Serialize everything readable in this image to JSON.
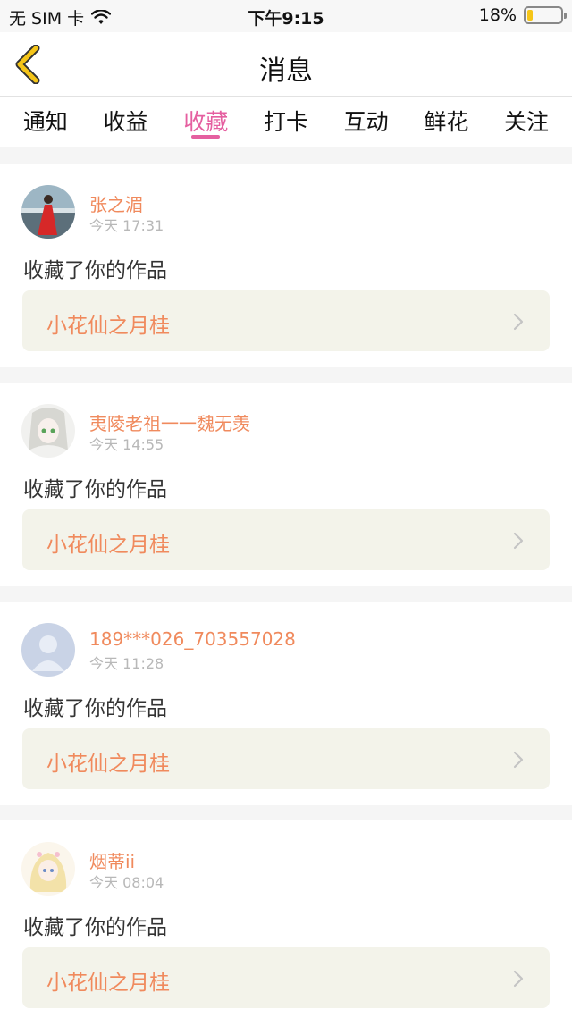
{
  "status_bar": {
    "carrier": "无 SIM 卡",
    "time": "下午9:15",
    "battery": "18%",
    "battery_level": 0.18
  },
  "nav": {
    "title": "消息",
    "back_icon": "chevron-left-icon"
  },
  "tabs": [
    {
      "label": "通知"
    },
    {
      "label": "收益"
    },
    {
      "label": "收藏",
      "active": true
    },
    {
      "label": "打卡"
    },
    {
      "label": "互动"
    },
    {
      "label": "鲜花"
    },
    {
      "label": "关注"
    }
  ],
  "messages": [
    {
      "username": "张之湄",
      "time": "今天 17:31",
      "action": "收藏了你的作品",
      "work": "小花仙之月桂"
    },
    {
      "username": "夷陵老祖一一魏无羡",
      "time": "今天 14:55",
      "action": "收藏了你的作品",
      "work": "小花仙之月桂"
    },
    {
      "username": "189***026_703557028",
      "time": "今天 11:28",
      "action": "收藏了你的作品",
      "work": "小花仙之月桂"
    },
    {
      "username": "烟蒂ii",
      "time": "今天 08:04",
      "action": "收藏了你的作品",
      "work": "小花仙之月桂"
    }
  ],
  "colors": {
    "accent": "#e55fa0",
    "name": "#f08a5d",
    "back_icon": "#f5c518",
    "link_bg": "#f3f3ea"
  }
}
